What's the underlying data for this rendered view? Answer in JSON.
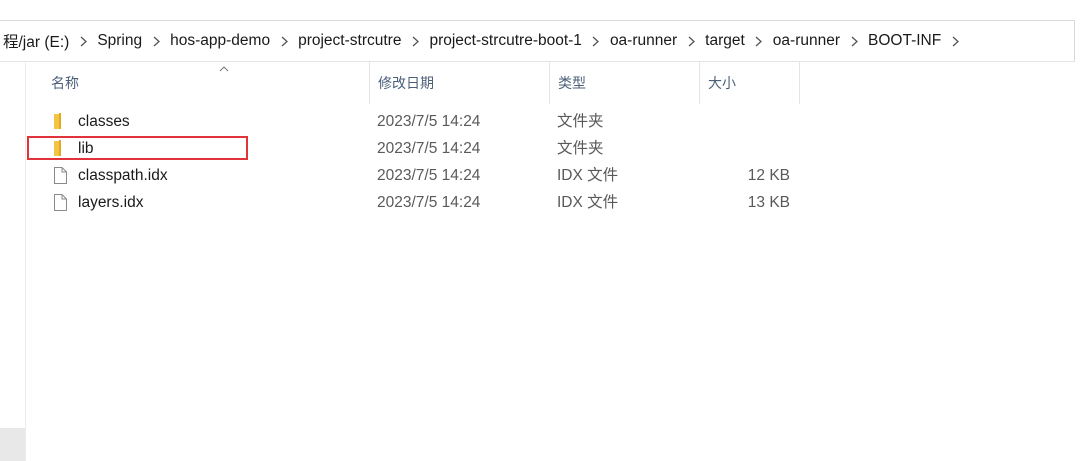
{
  "breadcrumb": {
    "items": [
      "程/jar (E:)",
      "Spring",
      "hos-app-demo",
      "project-strcutre",
      "project-strcutre-boot-1",
      "oa-runner",
      "target",
      "oa-runner",
      "BOOT-INF"
    ]
  },
  "columns": {
    "name": "名称",
    "date": "修改日期",
    "type": "类型",
    "size": "大小"
  },
  "files": [
    {
      "name": "classes",
      "date": "2023/7/5 14:24",
      "type": "文件夹",
      "size": "",
      "icon": "folder-icon"
    },
    {
      "name": "lib",
      "date": "2023/7/5 14:24",
      "type": "文件夹",
      "size": "",
      "icon": "folder-icon"
    },
    {
      "name": "classpath.idx",
      "date": "2023/7/5 14:24",
      "type": "IDX 文件",
      "size": "12 KB",
      "icon": "file-icon"
    },
    {
      "name": "layers.idx",
      "date": "2023/7/5 14:24",
      "type": "IDX 文件",
      "size": "13 KB",
      "icon": "file-icon"
    }
  ],
  "colors": {
    "folder": "#f4c542",
    "highlight": "#e0333a",
    "header_text": "#4c607a"
  }
}
